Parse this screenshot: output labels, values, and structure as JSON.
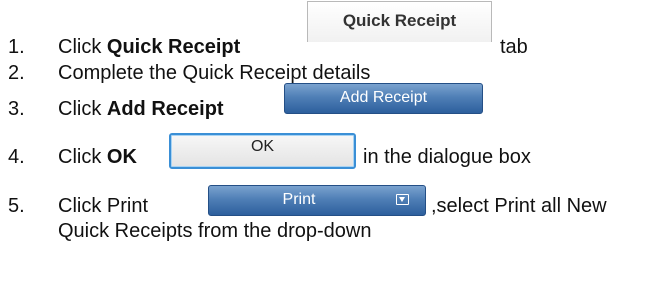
{
  "steps": [
    {
      "number": "1.",
      "prefix": "Click ",
      "bold": "Quick Receipt",
      "suffix": "tab",
      "button_label": "Quick Receipt"
    },
    {
      "number": "2.",
      "text": "Complete the Quick Receipt details"
    },
    {
      "number": "3.",
      "prefix": "Click ",
      "bold": "Add Receipt",
      "button_label": "Add Receipt"
    },
    {
      "number": "4.",
      "prefix": "Click ",
      "bold": "OK",
      "suffix": "in the dialogue box",
      "button_label": "OK"
    },
    {
      "number": "5.",
      "prefix": "Click Print",
      "suffix": ",select Print all New",
      "continuation": "Quick Receipts from the drop-down",
      "button_label": "Print",
      "button_icon": "dropdown-arrow-icon"
    }
  ],
  "colors": {
    "blue_button_top": "#7aa2cf",
    "blue_button_bottom": "#2d5f9d",
    "ok_border": "#3a8fd6"
  }
}
